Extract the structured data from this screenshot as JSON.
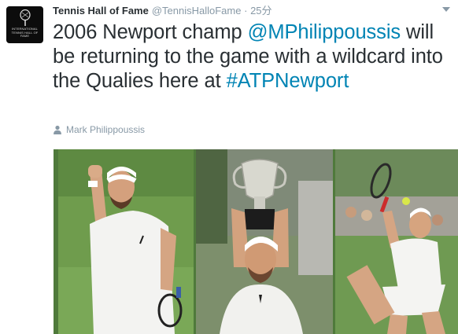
{
  "tweet": {
    "avatar_icon": "tennis-hall-of-fame-logo",
    "avatar_text": "INTERNATIONAL TENNIS HALL OF FAME",
    "author_name": "Tennis Hall of Fame",
    "author_handle": "@TennisHalloFame",
    "separator": "·",
    "timestamp": "25分",
    "text_part1": "2006 Newport champ ",
    "mention": "@MPhilippoussis",
    "text_part2": " will be returning to the game with a wildcard into the Qualies here at ",
    "hashtag": "#ATPNewport",
    "tagged_icon": "person-icon",
    "tagged_user": "Mark Philippoussis"
  },
  "media": {
    "photos": [
      {
        "name": "fist-pump-photo"
      },
      {
        "name": "trophy-photo"
      },
      {
        "name": "serve-photo"
      }
    ]
  },
  "colors": {
    "link": "#0084b4",
    "meta": "#8899a6",
    "text": "#292f33",
    "grass": "#4f7a3b"
  }
}
